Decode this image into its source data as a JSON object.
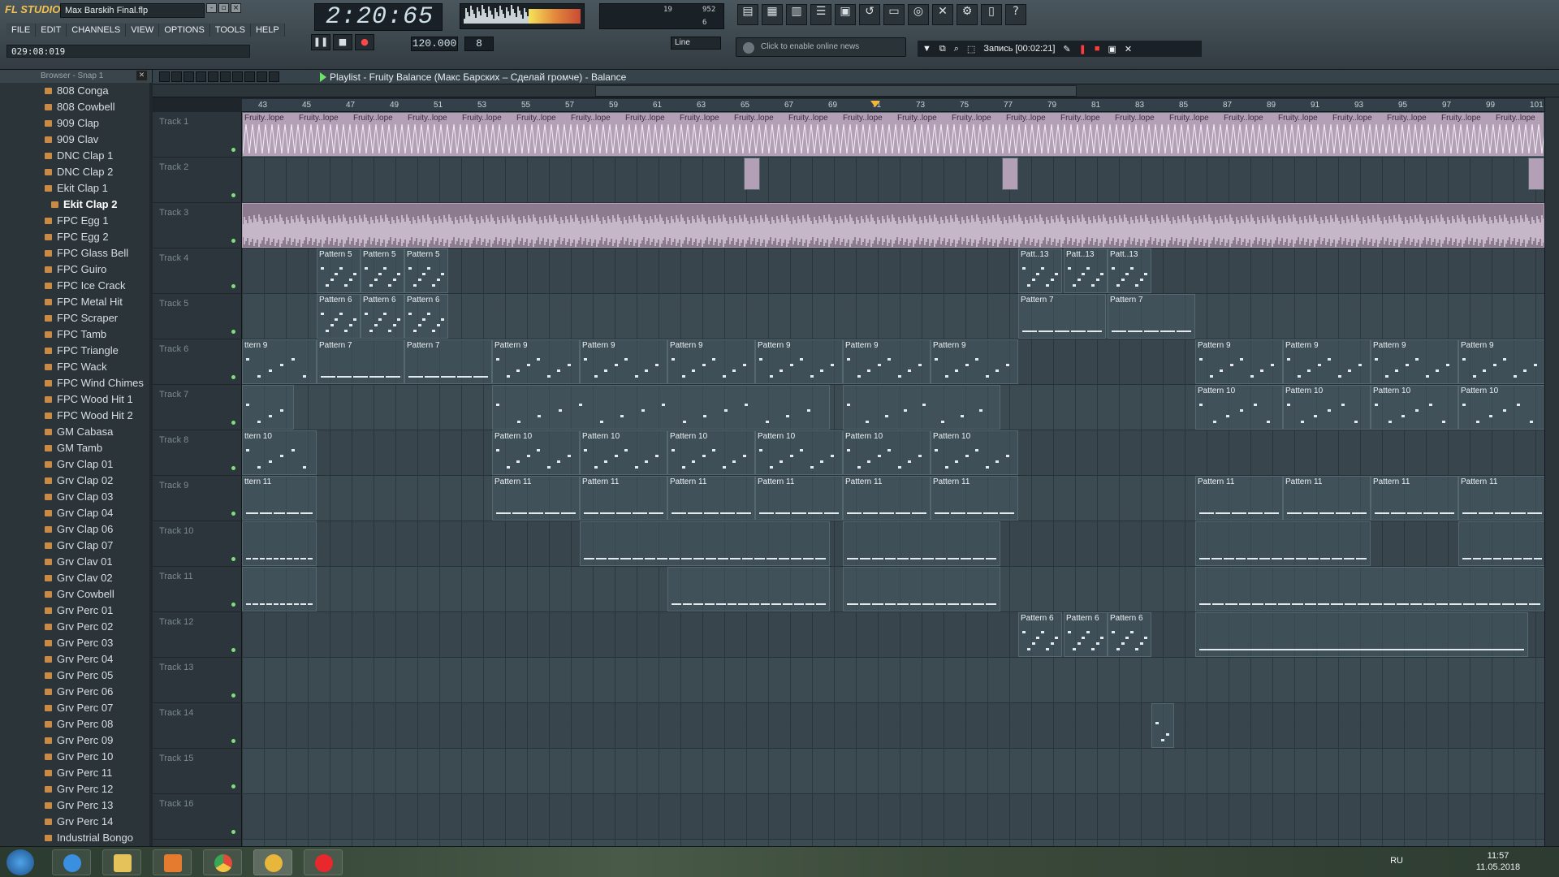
{
  "window": {
    "app_logo": "FL STUDIO",
    "project_file": "Max Barskih Final.flp",
    "controls": [
      "‑",
      "▫",
      "×"
    ]
  },
  "menu": [
    "FILE",
    "EDIT",
    "CHANNELS",
    "VIEW",
    "OPTIONS",
    "TOOLS",
    "HELP"
  ],
  "hint_bar": "029:08:019",
  "transport": {
    "time": "2:20:65",
    "tempo": "120.000",
    "pattern": "8",
    "line_mode": "Line",
    "cpu_values": [
      "19",
      "952",
      "6"
    ]
  },
  "news": "Click to enable online news",
  "recording": {
    "label": "Запись [00:02:21]"
  },
  "browser": {
    "title": "Browser - Snap 1",
    "selected": "Ekit Clap 2",
    "items": [
      "808 Conga",
      "808 Cowbell",
      "909 Clap",
      "909 Clav",
      "DNC Clap 1",
      "DNC Clap 2",
      "Ekit Clap 1",
      "Ekit Clap 2",
      "FPC Egg 1",
      "FPC Egg 2",
      "FPC Glass Bell",
      "FPC Guiro",
      "FPC Ice Crack",
      "FPC Metal Hit",
      "FPC Scraper",
      "FPC Tamb",
      "FPC Triangle",
      "FPC Wack",
      "FPC Wind Chimes",
      "FPC Wood Hit 1",
      "FPC Wood Hit 2",
      "GM Cabasa",
      "GM Tamb",
      "Grv Clap 01",
      "Grv Clap 02",
      "Grv Clap 03",
      "Grv Clap 04",
      "Grv Clap 06",
      "Grv Clap 07",
      "Grv Clav 01",
      "Grv Clav 02",
      "Grv Cowbell",
      "Grv Perc 01",
      "Grv Perc 02",
      "Grv Perc 03",
      "Grv Perc 04",
      "Grv Perc 05",
      "Grv Perc 06",
      "Grv Perc 07",
      "Grv Perc 08",
      "Grv Perc 09",
      "Grv Perc 10",
      "Grv Perc 11",
      "Grv Perc 12",
      "Grv Perc 13",
      "Grv Perc 14",
      "Industrial Bongo"
    ]
  },
  "playlist": {
    "title": "Playlist - Fruity Balance (Макс Барских – Сделай громче) - Balance",
    "ruler": [
      "43",
      "45",
      "47",
      "49",
      "51",
      "53",
      "55",
      "57",
      "59",
      "61",
      "63",
      "65",
      "67",
      "69",
      "71",
      "73",
      "75",
      "77",
      "79",
      "81",
      "83",
      "85",
      "87",
      "89",
      "91",
      "93",
      "95",
      "97",
      "99",
      "101"
    ],
    "tracks": [
      "Track 1",
      "Track 2",
      "Track 3",
      "Track 4",
      "Track 5",
      "Track 6",
      "Track 7",
      "Track 8",
      "Track 9",
      "Track 10",
      "Track 11",
      "Track 12",
      "Track 13",
      "Track 14",
      "Track 15",
      "Track 16"
    ],
    "clip_labels": {
      "fruity": "Fruity..lope",
      "p5": "Pattern 5",
      "p6": "Pattern 6",
      "p7": "Pattern 7",
      "p9": "Pattern 9",
      "p10": "Pattern 10",
      "p11": "Pattern 11",
      "p13": "Patt..13",
      "t9": "ttern 9",
      "t10": "ttern 10",
      "t11": "ttern 11"
    }
  },
  "taskbar": {
    "lang": "RU",
    "time": "11:57",
    "date": "11.05.2018"
  },
  "colors": {
    "accent": "#6fe26a",
    "playhead": "#f3b63b",
    "record": "#ff3b3b",
    "audio_clip": "#b4a0b6"
  }
}
